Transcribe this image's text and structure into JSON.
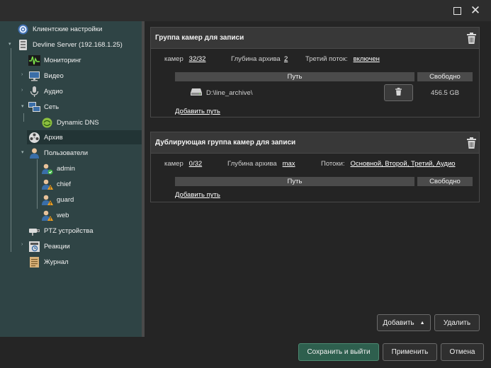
{
  "window": {
    "maximize_icon": "maximize-icon",
    "close_symbol": "✕"
  },
  "sidebar": {
    "items": [
      {
        "label": "Клиентские настройки",
        "icon": "client-settings-icon"
      },
      {
        "label": "Devline Server (192.168.1.25)",
        "icon": "server-icon"
      },
      {
        "label": "Мониторинг",
        "icon": "monitoring-icon"
      },
      {
        "label": "Видео",
        "icon": "video-icon"
      },
      {
        "label": "Аудио",
        "icon": "audio-icon"
      },
      {
        "label": "Сеть",
        "icon": "network-icon"
      },
      {
        "label": "Dynamic DNS",
        "icon": "dynamic-dns-icon"
      },
      {
        "label": "Архив",
        "icon": "archive-icon"
      },
      {
        "label": "Пользователи",
        "icon": "users-icon"
      },
      {
        "label": "admin",
        "icon": "user-ok-icon"
      },
      {
        "label": "chief",
        "icon": "user-warning-icon"
      },
      {
        "label": "guard",
        "icon": "user-warning-icon"
      },
      {
        "label": "web",
        "icon": "user-warning-icon"
      },
      {
        "label": "PTZ устройства",
        "icon": "ptz-icon"
      },
      {
        "label": "Реакции",
        "icon": "reactions-icon"
      },
      {
        "label": "Журнал",
        "icon": "journal-icon"
      }
    ]
  },
  "group1": {
    "title": "Группа камер для записи",
    "cameras_label": "камер",
    "cameras_value": "32/32",
    "depth_label": "Глубина архива",
    "depth_value": "2",
    "third_stream_label": "Третий поток:",
    "third_stream_value": "включен",
    "col_path": "Путь",
    "col_free": "Свободно",
    "path_value": "D:\\line_archive\\",
    "free_value": "456.5 GB",
    "add_path": "Добавить путь"
  },
  "group2": {
    "title": "Дублирующая группа камер для записи",
    "cameras_label": "камер",
    "cameras_value": "0/32",
    "depth_label": "Глубина архива",
    "depth_value": "max",
    "streams_label": "Потоки:",
    "streams_value": "Основной, Второй, Третий, Аудио",
    "col_path": "Путь",
    "col_free": "Свободно",
    "add_path": "Добавить путь"
  },
  "actions": {
    "add": "Добавить",
    "delete": "Удалить",
    "save_exit": "Сохранить и выйти",
    "apply": "Применить",
    "cancel": "Отмена"
  },
  "colors": {
    "sidebar_bg": "#2f4445",
    "primary_button": "#2e5f4e",
    "ok_badge": "#3cb043",
    "warning_badge": "#f0a020"
  }
}
